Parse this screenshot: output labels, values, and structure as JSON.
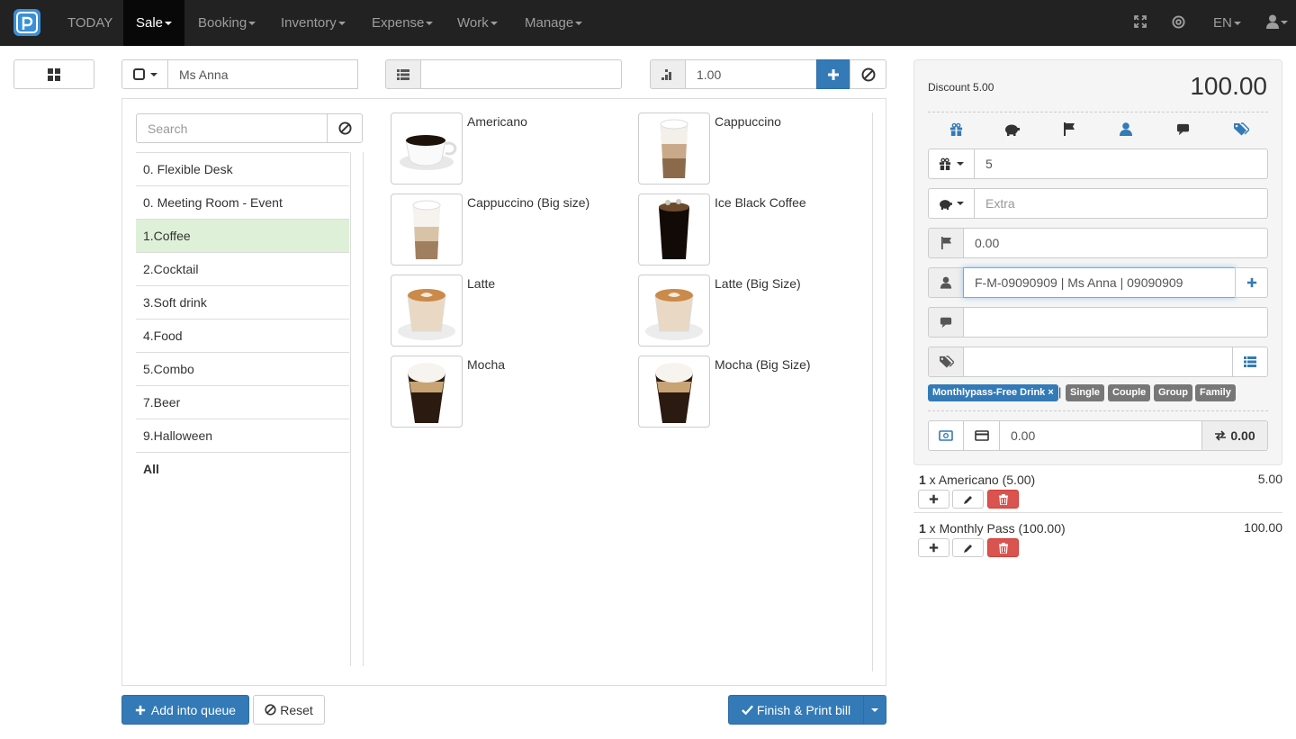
{
  "nav": {
    "today": "TODAY",
    "sale": "Sale",
    "booking": "Booking",
    "inventory": "Inventory",
    "expense": "Expense",
    "work": "Work",
    "manage": "Manage",
    "lang": "EN"
  },
  "toolbar": {
    "customer": "Ms Anna",
    "table_value": "",
    "quantity": "1.00"
  },
  "category_search": {
    "placeholder": "Search"
  },
  "categories": [
    "0. Flexible Desk",
    "0. Meeting Room - Event",
    "1.Coffee",
    "2.Cocktail",
    "3.Soft drink",
    "4.Food",
    "5.Combo",
    "7.Beer",
    "9.Halloween",
    "All"
  ],
  "active_category": "1.Coffee",
  "products": [
    "Americano",
    "Cappuccino",
    "Cappuccino (Big size)",
    "Ice Black Coffee",
    "Latte",
    "Latte (Big Size)",
    "Mocha",
    "Mocha (Big Size)"
  ],
  "summary": {
    "discount_label": "Discount 5.00",
    "total": "100.00",
    "discount_value": "5",
    "extra_placeholder": "Extra",
    "flag_value": "0.00",
    "customer_value": "F-M-09090909 | Ms Anna | 09090909",
    "note_value": "",
    "tags_value": "",
    "tags": {
      "active": "Monthlypass-Free Drink ×",
      "separator": "|",
      "options": [
        "Single",
        "Couple",
        "Group",
        "Family"
      ]
    },
    "payment_value": "0.00",
    "change_value": "0.00"
  },
  "order": [
    {
      "qty": "1",
      "text": " x Americano (5.00)",
      "amount": "5.00"
    },
    {
      "qty": "1",
      "text": " x Monthly Pass (100.00)",
      "amount": "100.00"
    }
  ],
  "footer": {
    "add_queue": "Add into queue",
    "reset": "Reset",
    "finish": "Finish & Print bill"
  },
  "colors": {
    "navbar": "#222222",
    "primary": "#337ab7",
    "danger": "#d9534f",
    "active_category": "#dff0d8",
    "logo": "#3a8fd6"
  }
}
